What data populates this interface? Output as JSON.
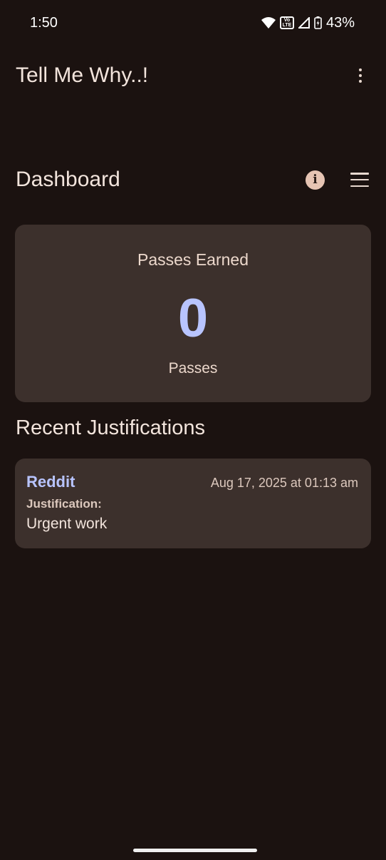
{
  "status_bar": {
    "time": "1:50",
    "battery_percent": "43%",
    "icons": [
      "wifi-icon",
      "volte-icon",
      "signal-icon",
      "battery-charging-icon"
    ],
    "volte_top": "Vo",
    "volte_bottom": "LTE"
  },
  "app_bar": {
    "title": "Tell Me Why..!",
    "overflow_icon": "more-vert-icon"
  },
  "dashboard": {
    "title": "Dashboard",
    "info_glyph": "i",
    "menu_icon": "hamburger-menu-icon"
  },
  "passes": {
    "label": "Passes Earned",
    "count": "0",
    "unit": "Passes"
  },
  "recent": {
    "title": "Recent Justifications",
    "items": [
      {
        "app": "Reddit",
        "date": "Aug 17, 2025 at 01:13 am",
        "label": "Justification:",
        "text": "Urgent work"
      }
    ]
  },
  "colors": {
    "background": "#1b1210",
    "card": "#3c302c",
    "accent": "#b8c4ff",
    "info_icon_bg": "#e6c4b3"
  }
}
